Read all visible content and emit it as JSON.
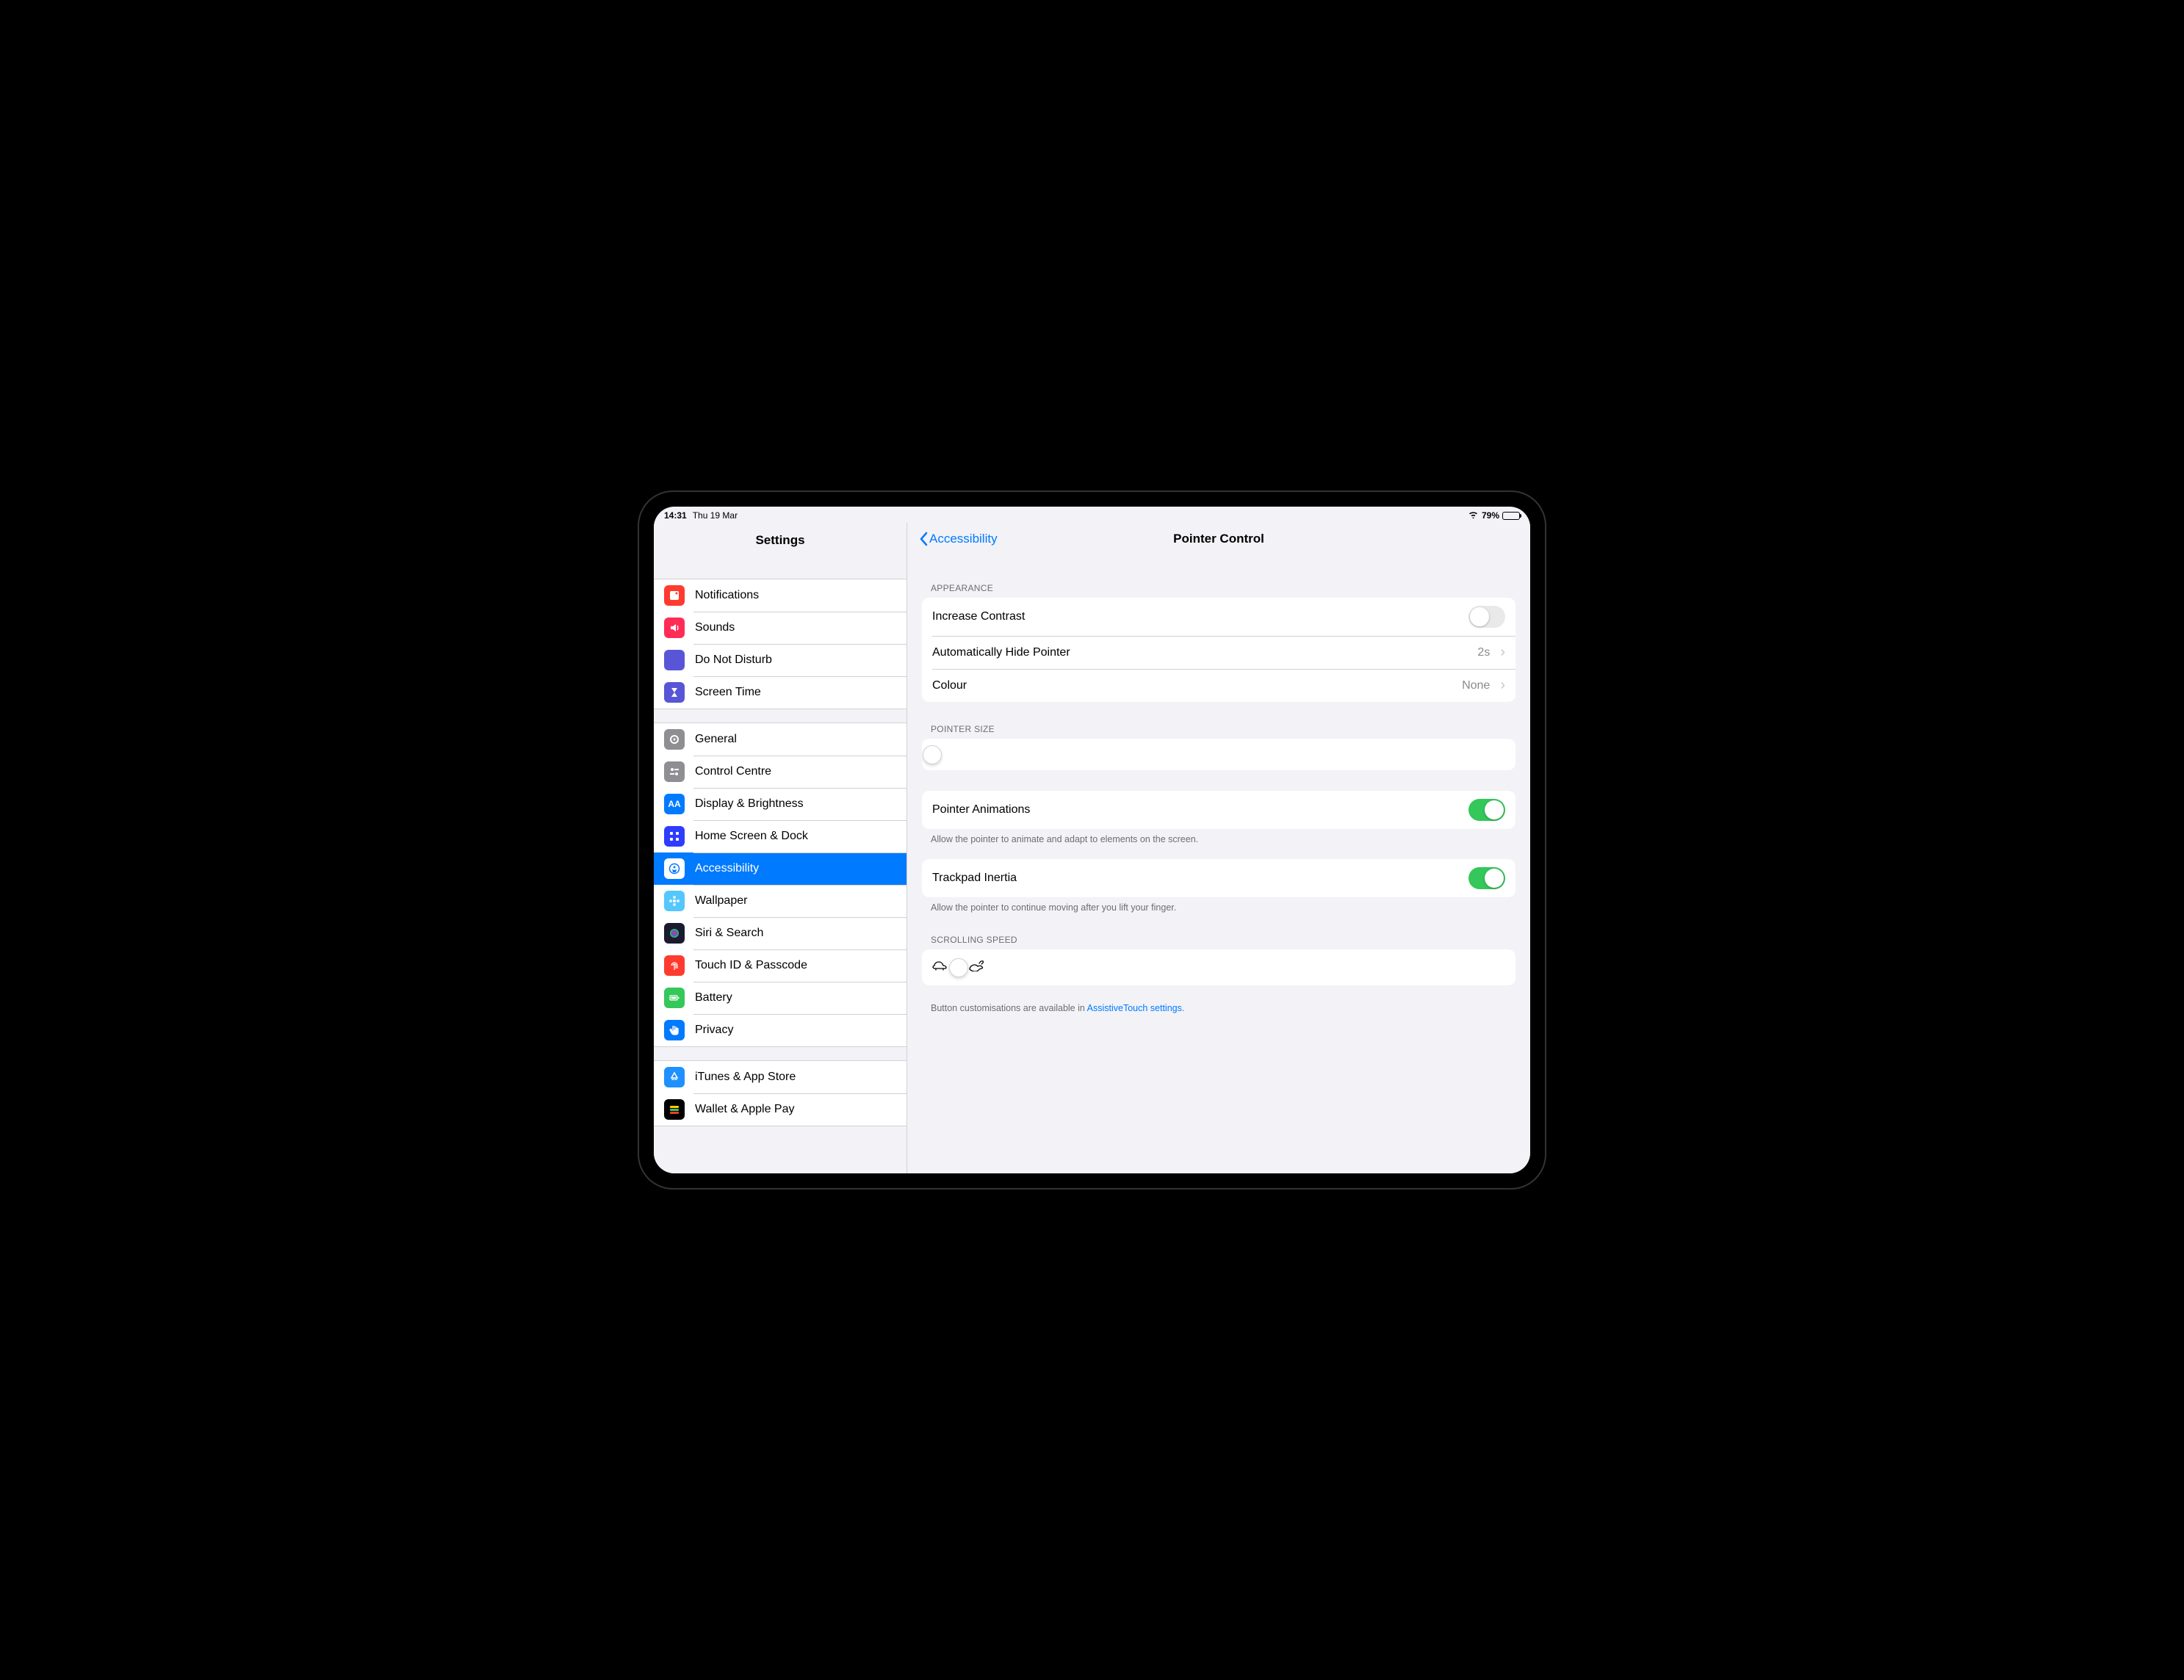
{
  "status": {
    "time": "14:31",
    "date": "Thu 19 Mar",
    "battery_pct": "79%"
  },
  "sidebar": {
    "title": "Settings",
    "groups": [
      [
        {
          "label": "Notifications",
          "bg": "#ff3b30",
          "glyph": "square"
        },
        {
          "label": "Sounds",
          "bg": "#ff2d55",
          "glyph": "speaker"
        },
        {
          "label": "Do Not Disturb",
          "bg": "#5856d6",
          "glyph": "moon"
        },
        {
          "label": "Screen Time",
          "bg": "#5856d6",
          "glyph": "hourglass"
        }
      ],
      [
        {
          "label": "General",
          "bg": "#8e8e93",
          "glyph": "gear"
        },
        {
          "label": "Control Centre",
          "bg": "#8e8e93",
          "glyph": "sliders"
        },
        {
          "label": "Display & Brightness",
          "bg": "#007aff",
          "glyph": "AA"
        },
        {
          "label": "Home Screen & Dock",
          "bg": "#2e3cff",
          "glyph": "grid"
        },
        {
          "label": "Accessibility",
          "bg": "#007aff",
          "glyph": "person",
          "selected": true
        },
        {
          "label": "Wallpaper",
          "bg": "#54c7fc",
          "glyph": "flower"
        },
        {
          "label": "Siri & Search",
          "bg": "#1b1b2f",
          "glyph": "siri"
        },
        {
          "label": "Touch ID & Passcode",
          "bg": "#ff3b30",
          "glyph": "fingerprint"
        },
        {
          "label": "Battery",
          "bg": "#34c759",
          "glyph": "battery"
        },
        {
          "label": "Privacy",
          "bg": "#007aff",
          "glyph": "hand"
        }
      ],
      [
        {
          "label": "iTunes & App Store",
          "bg": "#1e90ff",
          "glyph": "appstore"
        },
        {
          "label": "Wallet & Apple Pay",
          "bg": "#000",
          "glyph": "wallet"
        }
      ]
    ]
  },
  "detail": {
    "back_label": "Accessibility",
    "title": "Pointer Control",
    "sections": {
      "appearance": {
        "header": "APPEARANCE",
        "increase_contrast": {
          "label": "Increase Contrast",
          "on": false
        },
        "auto_hide": {
          "label": "Automatically Hide Pointer",
          "value": "2s"
        },
        "colour": {
          "label": "Colour",
          "value": "None"
        }
      },
      "pointer_size": {
        "header": "POINTER SIZE",
        "value_pct": 3
      },
      "animations": {
        "label": "Pointer Animations",
        "on": true,
        "footer": "Allow the pointer to animate and adapt to elements on the screen."
      },
      "inertia": {
        "label": "Trackpad Inertia",
        "on": true,
        "footer": "Allow the pointer to continue moving after you lift your finger."
      },
      "scrolling": {
        "header": "SCROLLING SPEED",
        "value_pct": 31
      },
      "footer_note_pre": "Button customisations are available in ",
      "footer_note_link": "AssistiveTouch settings",
      "footer_note_post": "."
    }
  }
}
